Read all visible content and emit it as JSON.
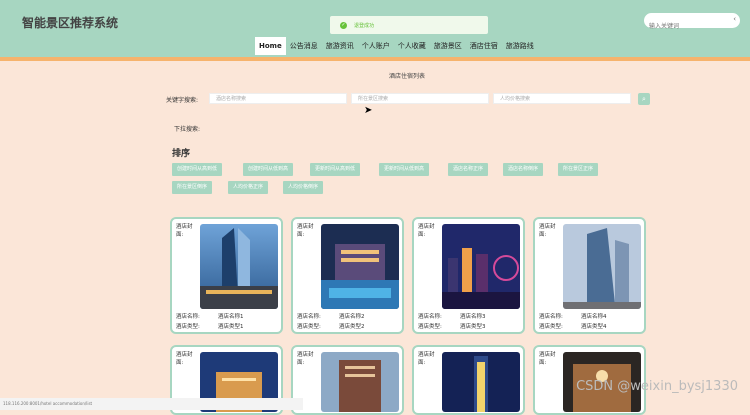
{
  "header": {
    "title": "智能景区推荐系统",
    "toast": "退登成功",
    "search_placeholder": "输入关键词"
  },
  "nav": [
    "Home",
    "公告消息",
    "旅游资讯",
    "个人账户",
    "个人收藏",
    "旅游景区",
    "酒店住宿",
    "旅游路线"
  ],
  "page_title": "酒店住宿列表",
  "filters": {
    "keyword_label": "关键字搜索:",
    "hotel_name_placeholder": "酒店名称搜索",
    "scenic_area_placeholder": "所在景区搜索",
    "price_placeholder": "人均价格搜索",
    "dropdown_label": "下拉搜索:"
  },
  "sort": {
    "title": "排序",
    "buttons": [
      "创建时间从高到低",
      "创建时间从低到高",
      "更新时间从高到低",
      "更新时间从低到高",
      "酒店名称正序",
      "酒店名称倒序",
      "所在景区正序",
      "所在景区倒序",
      "人均价格正序",
      "人均价格倒序"
    ]
  },
  "cards": [
    {
      "cover_label": "酒店封面:",
      "name_label": "酒店名称:",
      "name": "酒店名称1",
      "type_label": "酒店类型:",
      "type": "酒店类型1"
    },
    {
      "cover_label": "酒店封面:",
      "name_label": "酒店名称:",
      "name": "酒店名称2",
      "type_label": "酒店类型:",
      "type": "酒店类型2"
    },
    {
      "cover_label": "酒店封面:",
      "name_label": "酒店名称:",
      "name": "酒店名称3",
      "type_label": "酒店类型:",
      "type": "酒店类型3"
    },
    {
      "cover_label": "酒店封面:",
      "name_label": "酒店名称:",
      "name": "酒店名称4",
      "type_label": "酒店类型:",
      "type": "酒店类型4"
    },
    {
      "cover_label": "酒店封面:"
    },
    {
      "cover_label": "酒店封面:"
    },
    {
      "cover_label": "酒店封面:"
    },
    {
      "cover_label": "酒店封面:"
    }
  ],
  "status_url": "118.116.200:8001/hotel accommodation/list",
  "watermark": "CSDN @weixin_bysj1330",
  "colors": {
    "header": "#a7d6c1",
    "background": "#fbe6d8",
    "accent_bar": "#f6b36c",
    "button": "#a7d6c1"
  }
}
